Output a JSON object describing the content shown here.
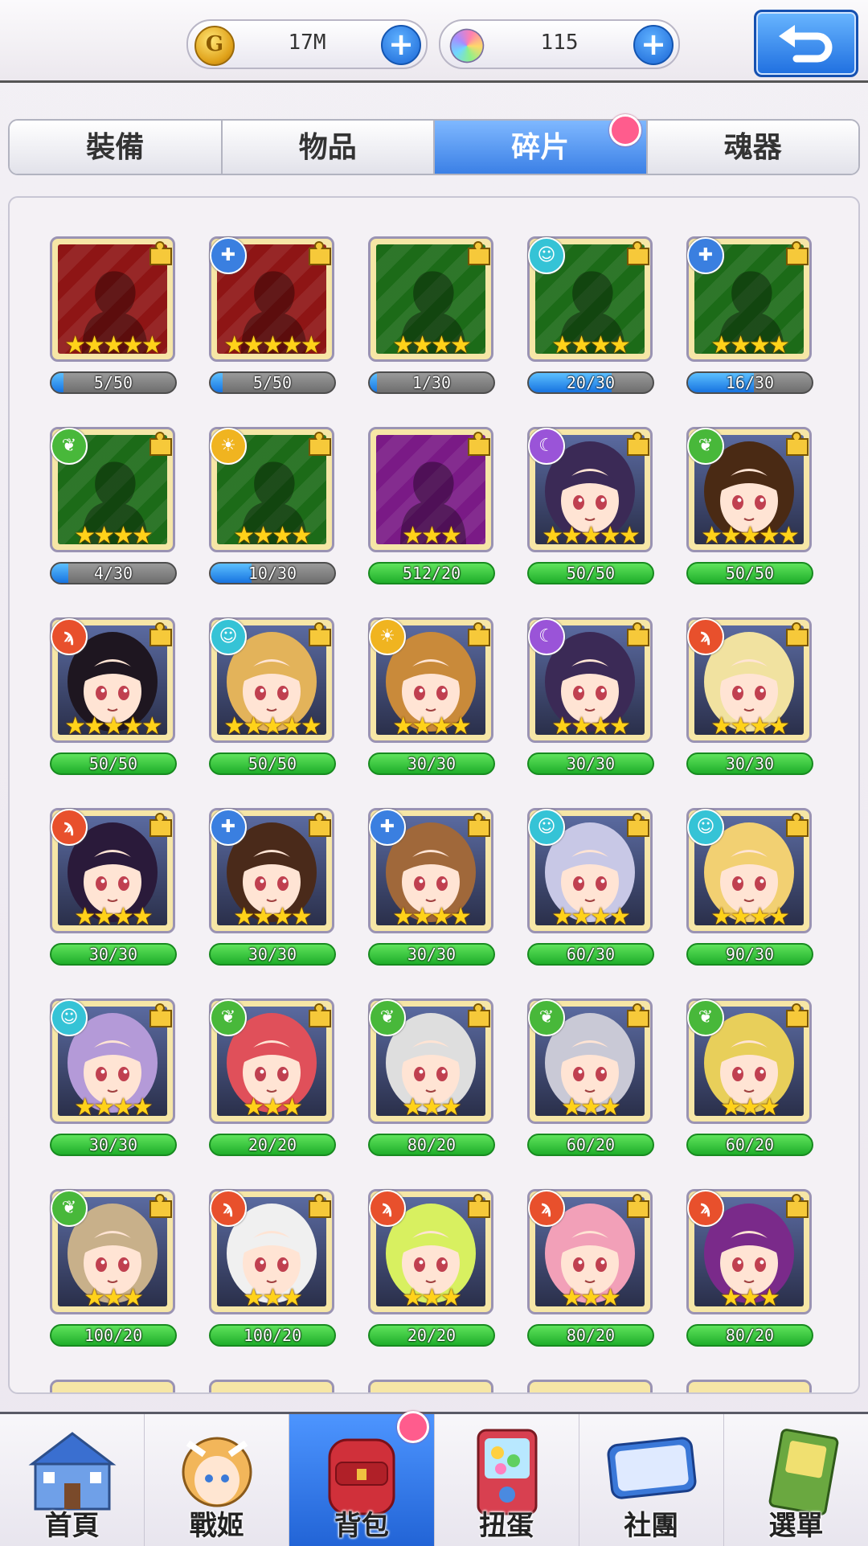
{
  "resources": {
    "gold": {
      "value": "17M",
      "icon": "coin-icon"
    },
    "gems": {
      "value": "115",
      "icon": "gem-icon"
    },
    "plus_label": "+"
  },
  "tabs": [
    {
      "label": "裝備"
    },
    {
      "label": "物品"
    },
    {
      "label": "碎片",
      "active": true,
      "badge": true
    },
    {
      "label": "魂器"
    }
  ],
  "element_colors": {
    "fire": "#e8502c",
    "water": "#35c3d6",
    "light": "#f0b420",
    "dark": "#9a54d8",
    "nature": "#48b83a",
    "shield": "#3a7fe0"
  },
  "items": [
    {
      "progress": "5/50",
      "cur": 5,
      "max": 50,
      "stars": 5,
      "element": "",
      "silhouette": "#8e1515"
    },
    {
      "progress": "5/50",
      "cur": 5,
      "max": 50,
      "stars": 5,
      "element": "shield",
      "silhouette": "#8e1515"
    },
    {
      "progress": "1/30",
      "cur": 1,
      "max": 30,
      "stars": 4,
      "element": "",
      "silhouette": "#1c6b18"
    },
    {
      "progress": "20/30",
      "cur": 20,
      "max": 30,
      "stars": 4,
      "element": "water",
      "silhouette": "#1c6b18"
    },
    {
      "progress": "16/30",
      "cur": 16,
      "max": 30,
      "stars": 4,
      "element": "shield",
      "silhouette": "#1c6b18"
    },
    {
      "progress": "4/30",
      "cur": 4,
      "max": 30,
      "stars": 4,
      "element": "nature",
      "silhouette": "#1c6b18"
    },
    {
      "progress": "10/30",
      "cur": 10,
      "max": 30,
      "stars": 4,
      "element": "light",
      "silhouette": "#1c6b18"
    },
    {
      "progress": "512/20",
      "cur": 512,
      "max": 20,
      "stars": 3,
      "element": "",
      "silhouette": "#7a1a86"
    },
    {
      "progress": "50/50",
      "cur": 50,
      "max": 50,
      "stars": 5,
      "element": "dark",
      "hair": "#3b2a56"
    },
    {
      "progress": "50/50",
      "cur": 50,
      "max": 50,
      "stars": 5,
      "element": "nature",
      "hair": "#4a2a14"
    },
    {
      "progress": "50/50",
      "cur": 50,
      "max": 50,
      "stars": 5,
      "element": "fire",
      "hair": "#1e1620"
    },
    {
      "progress": "50/50",
      "cur": 50,
      "max": 50,
      "stars": 5,
      "element": "water",
      "hair": "#e3b35a"
    },
    {
      "progress": "30/30",
      "cur": 30,
      "max": 30,
      "stars": 4,
      "element": "light",
      "hair": "#c98a3a"
    },
    {
      "progress": "30/30",
      "cur": 30,
      "max": 30,
      "stars": 4,
      "element": "dark",
      "hair": "#3b2a56"
    },
    {
      "progress": "30/30",
      "cur": 30,
      "max": 30,
      "stars": 4,
      "element": "fire",
      "hair": "#f1e2a0"
    },
    {
      "progress": "30/30",
      "cur": 30,
      "max": 30,
      "stars": 4,
      "element": "fire",
      "hair": "#2a1a3a"
    },
    {
      "progress": "30/30",
      "cur": 30,
      "max": 30,
      "stars": 4,
      "element": "shield",
      "hair": "#4a2a1a"
    },
    {
      "progress": "30/30",
      "cur": 30,
      "max": 30,
      "stars": 4,
      "element": "shield",
      "hair": "#a0683a"
    },
    {
      "progress": "60/30",
      "cur": 60,
      "max": 30,
      "stars": 4,
      "element": "water",
      "hair": "#c8c8e6"
    },
    {
      "progress": "90/30",
      "cur": 90,
      "max": 30,
      "stars": 4,
      "element": "water",
      "hair": "#f2d072"
    },
    {
      "progress": "30/30",
      "cur": 30,
      "max": 30,
      "stars": 4,
      "element": "water",
      "hair": "#b49ad8"
    },
    {
      "progress": "20/20",
      "cur": 20,
      "max": 20,
      "stars": 3,
      "element": "nature",
      "hair": "#e0505a"
    },
    {
      "progress": "80/20",
      "cur": 80,
      "max": 20,
      "stars": 3,
      "element": "nature",
      "hair": "#dedede"
    },
    {
      "progress": "60/20",
      "cur": 60,
      "max": 20,
      "stars": 3,
      "element": "nature",
      "hair": "#c9c9d6"
    },
    {
      "progress": "60/20",
      "cur": 60,
      "max": 20,
      "stars": 3,
      "element": "nature",
      "hair": "#e8cf5a"
    },
    {
      "progress": "100/20",
      "cur": 100,
      "max": 20,
      "stars": 3,
      "element": "nature",
      "hair": "#c8b08a"
    },
    {
      "progress": "100/20",
      "cur": 100,
      "max": 20,
      "stars": 3,
      "element": "fire",
      "hair": "#f0f0f0"
    },
    {
      "progress": "20/20",
      "cur": 20,
      "max": 20,
      "stars": 3,
      "element": "fire",
      "hair": "#d8f060"
    },
    {
      "progress": "80/20",
      "cur": 80,
      "max": 20,
      "stars": 3,
      "element": "fire",
      "hair": "#f2a0b8"
    },
    {
      "progress": "80/20",
      "cur": 80,
      "max": 20,
      "stars": 3,
      "element": "fire",
      "hair": "#7a2a8a"
    }
  ],
  "nav": [
    {
      "label": "首頁"
    },
    {
      "label": "戰姬"
    },
    {
      "label": "背包",
      "active": true,
      "badge": true
    },
    {
      "label": "扭蛋"
    },
    {
      "label": "社團"
    },
    {
      "label": "選單"
    }
  ]
}
